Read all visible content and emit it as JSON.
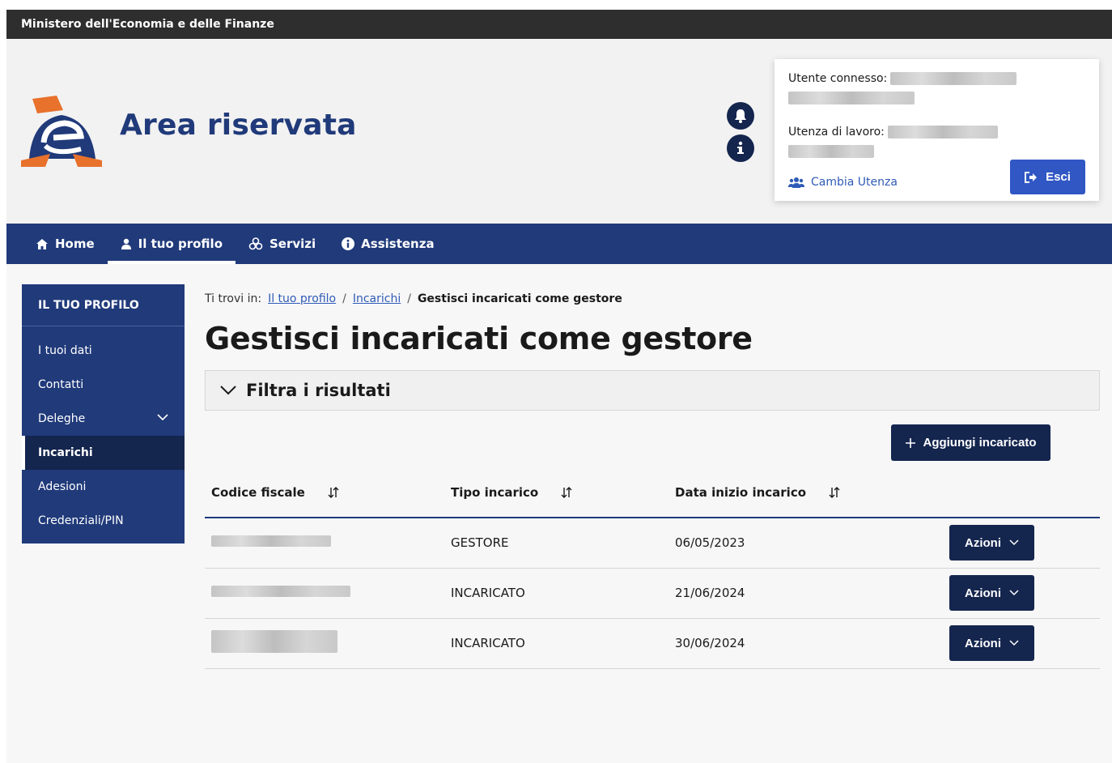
{
  "slim_header": {
    "ministry": "Ministero dell'Economia e delle Finanze"
  },
  "header": {
    "site_title": "Area riservata",
    "icons": [
      "bell-icon",
      "info-icon"
    ],
    "user_card": {
      "connected_label": "Utente connesso:",
      "work_label": "Utenza di lavoro:",
      "change_user_label": "Cambia Utenza",
      "logout_label": "Esci"
    }
  },
  "navbar": {
    "items": [
      {
        "label": "Home",
        "icon": "home-icon",
        "active": false
      },
      {
        "label": "Il tuo profilo",
        "icon": "user-icon",
        "active": true
      },
      {
        "label": "Servizi",
        "icon": "services-icon",
        "active": false
      },
      {
        "label": "Assistenza",
        "icon": "info-icon",
        "active": false
      }
    ]
  },
  "sidebar": {
    "title": "IL TUO PROFILO",
    "items": [
      {
        "label": "I tuoi dati"
      },
      {
        "label": "Contatti"
      },
      {
        "label": "Deleghe"
      },
      {
        "label": "Incarichi"
      },
      {
        "label": "Adesioni"
      },
      {
        "label": "Credenziali/PIN"
      }
    ]
  },
  "breadcrumb": {
    "prefix": "Ti trovi in:",
    "links": [
      "Il tuo profilo",
      "Incarichi"
    ],
    "separator": "/",
    "current": "Gestisci incaricati come gestore"
  },
  "page_title": "Gestisci incaricati come gestore",
  "filter_label": "Filtra i risultati",
  "add_button_label": "Aggiungi incaricato",
  "table": {
    "headers": [
      "Codice fiscale",
      "Tipo incarico",
      "Data inizio incarico"
    ],
    "rows": [
      {
        "tipo": "GESTORE",
        "data": "06/05/2023",
        "action": "Azioni"
      },
      {
        "tipo": "INCARICATO",
        "data": "21/06/2024",
        "action": "Azioni"
      },
      {
        "tipo": "INCARICATO",
        "data": "30/06/2024",
        "action": "Azioni"
      }
    ]
  },
  "colors": {
    "primary": "#203a7a",
    "dark_button": "#14254e",
    "accent_button": "#3057c4",
    "link": "#2f5bb7",
    "logo_orange": "#e8712c"
  }
}
